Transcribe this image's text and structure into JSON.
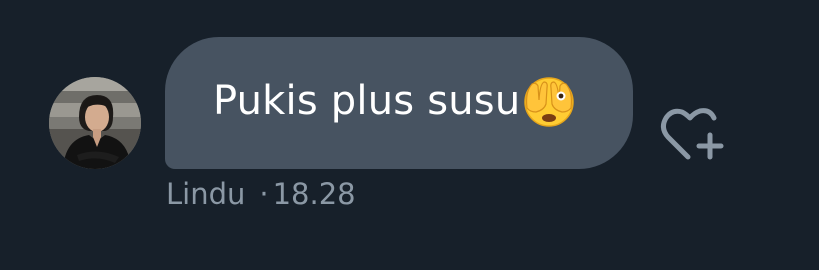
{
  "message": {
    "text": "Pukis plus susu",
    "emoji": "face-with-hand-over-eyes-emoji",
    "sender": "Lindu",
    "separator": "·",
    "time": "18.28"
  },
  "icons": {
    "avatar": "avatar-photo",
    "react": "heart-plus-icon"
  },
  "colors": {
    "background": "#17202a",
    "bubble": "#475361",
    "text": "#ffffff",
    "meta": "#8b98a5"
  }
}
